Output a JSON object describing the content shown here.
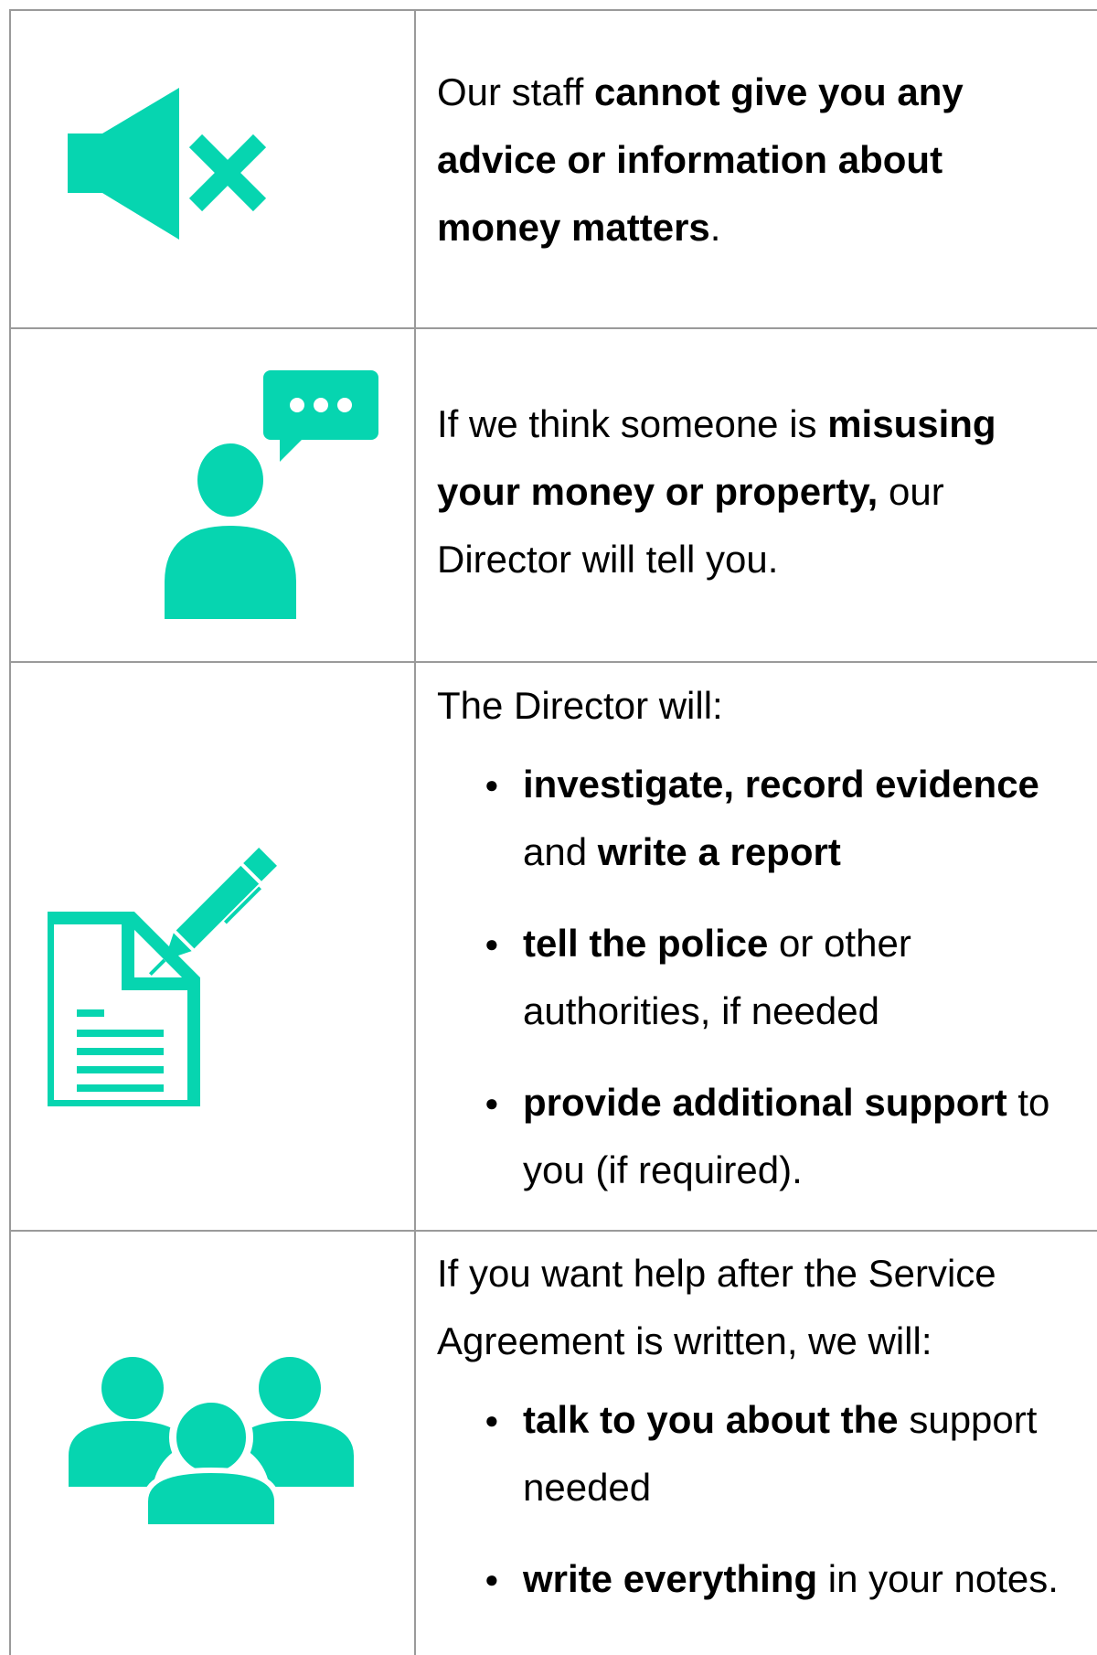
{
  "colors": {
    "accent": "#06d5b0",
    "border": "#9a9a9a"
  },
  "rows": [
    {
      "icon": "speaker-muted-icon",
      "segments": [
        {
          "text": "Our staff ",
          "bold": false
        },
        {
          "text": "cannot give you any advice or information about money matters",
          "bold": true
        },
        {
          "text": ".",
          "bold": false
        }
      ],
      "lines": [
        [
          {
            "text": "Our staff ",
            "bold": false
          },
          {
            "text": "cannot give you any",
            "bold": true
          }
        ],
        [
          {
            "text": "advice or information about",
            "bold": true
          }
        ],
        [
          {
            "text": "money matters",
            "bold": true
          },
          {
            "text": ".",
            "bold": false
          }
        ]
      ]
    },
    {
      "icon": "person-speech-bubble-icon",
      "lines": [
        [
          {
            "text": "If we think someone is ",
            "bold": false
          },
          {
            "text": "misusing",
            "bold": true
          }
        ],
        [
          {
            "text": "your money or property,",
            "bold": true
          },
          {
            "text": " our",
            "bold": false
          }
        ],
        [
          {
            "text": "Director will tell you.",
            "bold": false
          }
        ]
      ]
    },
    {
      "icon": "document-pen-icon",
      "intro": "The Director will:",
      "bullets": [
        [
          [
            {
              "text": "investigate, record evidence",
              "bold": true
            }
          ],
          [
            {
              "text": "and ",
              "bold": false
            },
            {
              "text": "write a report",
              "bold": true
            }
          ]
        ],
        [
          [
            {
              "text": "tell the police",
              "bold": true
            },
            {
              "text": " or other",
              "bold": false
            }
          ],
          [
            {
              "text": "authorities, if needed",
              "bold": false
            }
          ]
        ],
        [
          [
            {
              "text": "provide additional support",
              "bold": true
            },
            {
              "text": " to",
              "bold": false
            }
          ],
          [
            {
              "text": "you (if required).",
              "bold": false
            }
          ]
        ]
      ]
    },
    {
      "icon": "group-of-people-icon",
      "intro_lines": [
        "If you want help after the Service",
        "Agreement is written, we will:"
      ],
      "bullets": [
        [
          [
            {
              "text": "talk to you about the",
              "bold": true
            },
            {
              "text": " support",
              "bold": false
            }
          ],
          [
            {
              "text": "needed",
              "bold": false
            }
          ]
        ],
        [
          [
            {
              "text": "write everything",
              "bold": true
            },
            {
              "text": " in your notes.",
              "bold": false
            }
          ]
        ]
      ]
    }
  ]
}
